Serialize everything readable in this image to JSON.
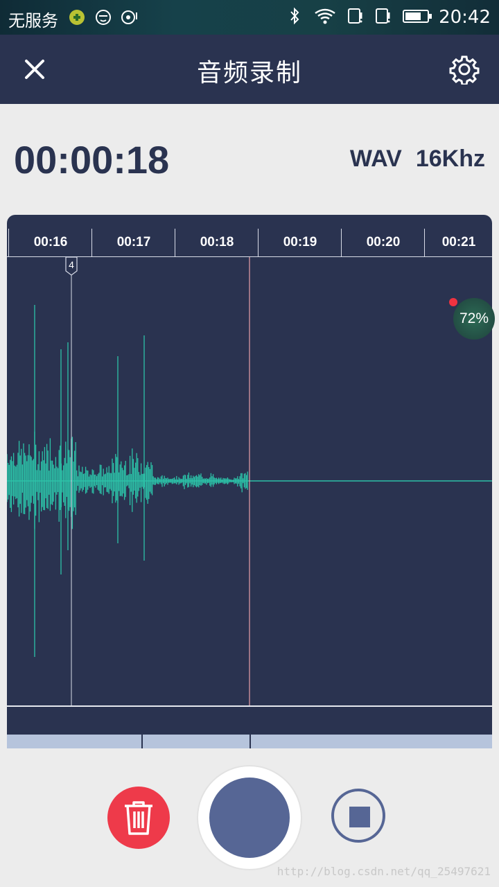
{
  "status_bar": {
    "carrier": "无服务",
    "clock": "20:42",
    "icons": [
      "app-notification-icon",
      "face-icon",
      "radio-icon",
      "bluetooth-icon",
      "wifi-icon",
      "sim-1-icon",
      "sim-2-icon",
      "battery-icon"
    ]
  },
  "header": {
    "title": "音频录制",
    "close_icon": "close-icon",
    "settings_icon": "gear-icon"
  },
  "recording": {
    "elapsed": "00:00:18",
    "format": "WAV",
    "sample_rate": "16Khz"
  },
  "timeline": {
    "ticks": [
      "00:16",
      "00:17",
      "00:18",
      "00:19",
      "00:20",
      "00:21"
    ],
    "marker_label": "4"
  },
  "colors": {
    "primary": "#2a3350",
    "waveform": "#2cc2a8",
    "playhead": "#e8a0a8",
    "delete": "#ee3a4a",
    "record": "#566695"
  },
  "badge": {
    "label": "72%"
  },
  "controls": {
    "delete_icon": "trash-icon",
    "record_icon": "record-icon",
    "stop_icon": "stop-icon"
  },
  "watermark": "http://blog.csdn.net/qq_25497621"
}
